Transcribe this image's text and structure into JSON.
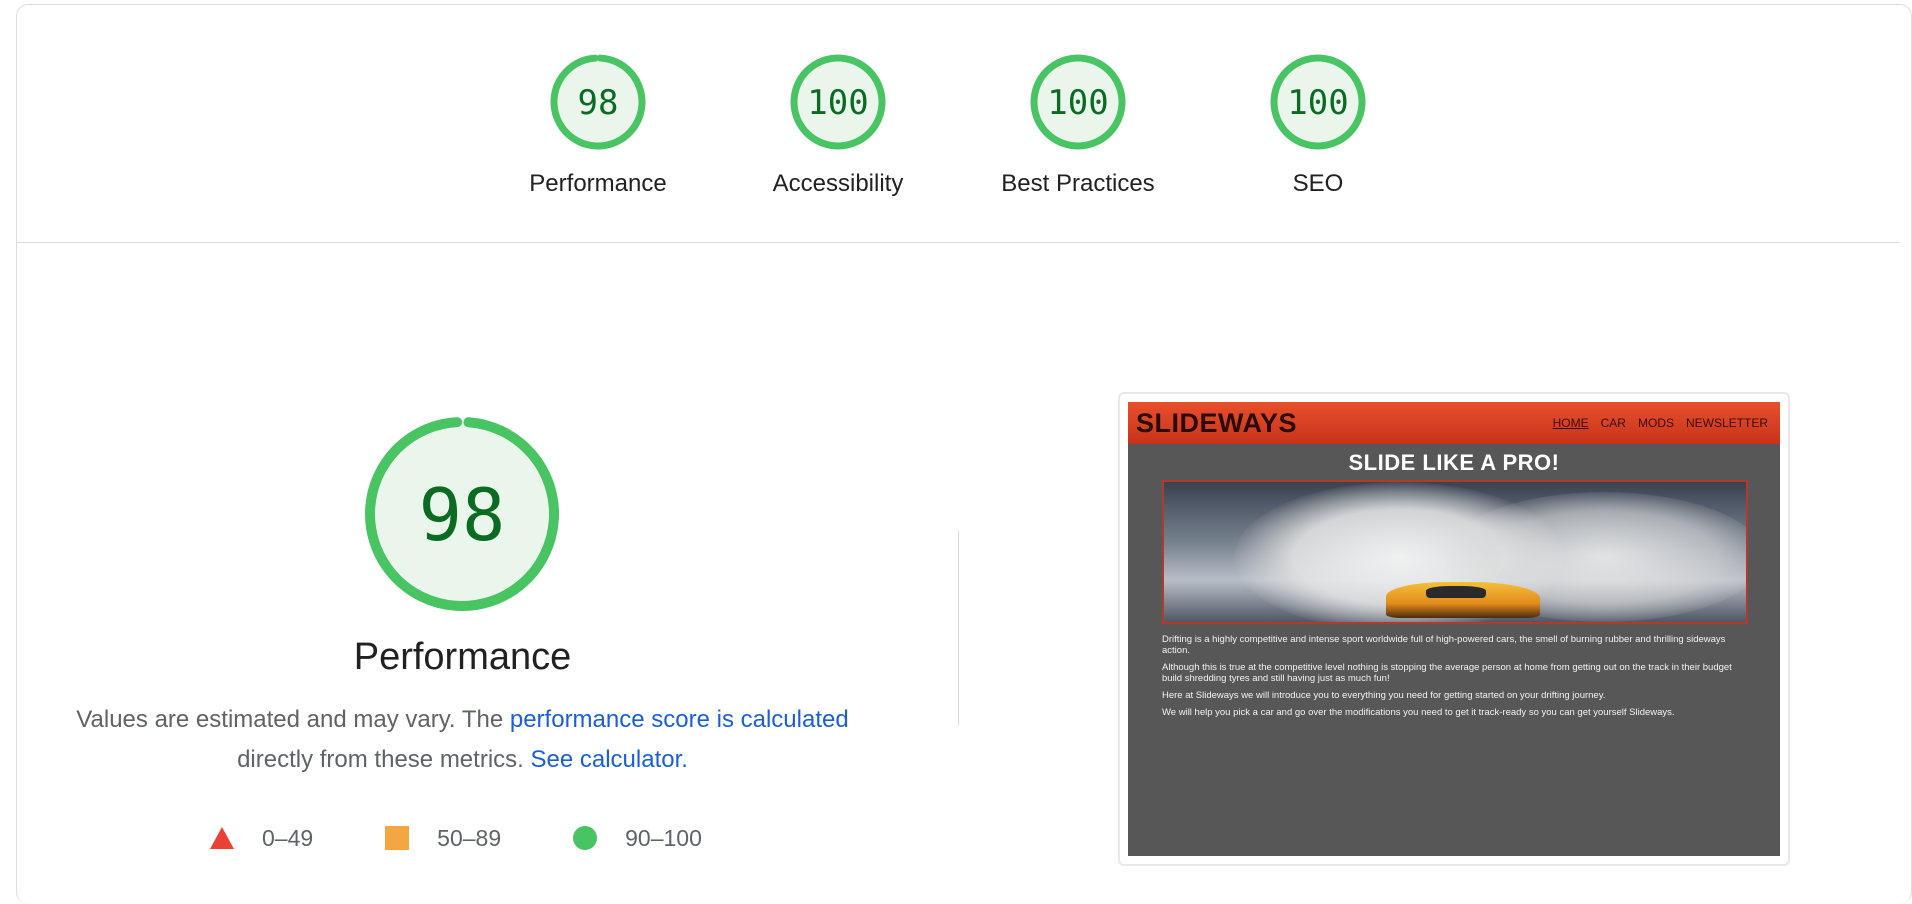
{
  "scores": [
    {
      "label": "Performance",
      "value": "98",
      "score": 0.98
    },
    {
      "label": "Accessibility",
      "value": "100",
      "score": 1.0
    },
    {
      "label": "Best Practices",
      "value": "100",
      "score": 1.0
    },
    {
      "label": "SEO",
      "value": "100",
      "score": 1.0
    }
  ],
  "performance": {
    "value": "98",
    "score": 0.98,
    "title": "Performance",
    "desc_prefix": "Values are estimated and may vary. The",
    "desc_link": "performance score is calculated",
    "desc_middle": "directly from these metrics.",
    "desc_calc_link": "See calculator."
  },
  "legend": [
    {
      "range": "0–49",
      "color": "#eb4034",
      "shape": "triangle"
    },
    {
      "range": "50–89",
      "color": "#f4a640",
      "shape": "square"
    },
    {
      "range": "90–100",
      "color": "#48c463",
      "shape": "circle"
    }
  ],
  "colors": {
    "pass": "#48c463",
    "pass_fill": "#eaf6ec",
    "pass_text": "#0c6b23",
    "link": "#1a5fd8"
  },
  "screenshot": {
    "logo": "SLIDEWAYS",
    "nav": [
      "HOME",
      "CAR",
      "MODS",
      "NEWSLETTER"
    ],
    "heading": "SLIDE LIKE A PRO!",
    "paragraphs": [
      "Drifting is a highly competitive and intense sport worldwide full of high-powered cars, the smell of burning rubber and thrilling sideways action.",
      "Although this is true at the competitive level nothing is stopping the average person at home from getting out on the track in their budget build shredding tyres and still having just as much fun!",
      "Here at Slideways we will introduce you to everything you need for getting started on your drifting journey.",
      "We will help you pick a car and go over the modifications you need to get it track-ready so you can get yourself Slideways."
    ]
  }
}
